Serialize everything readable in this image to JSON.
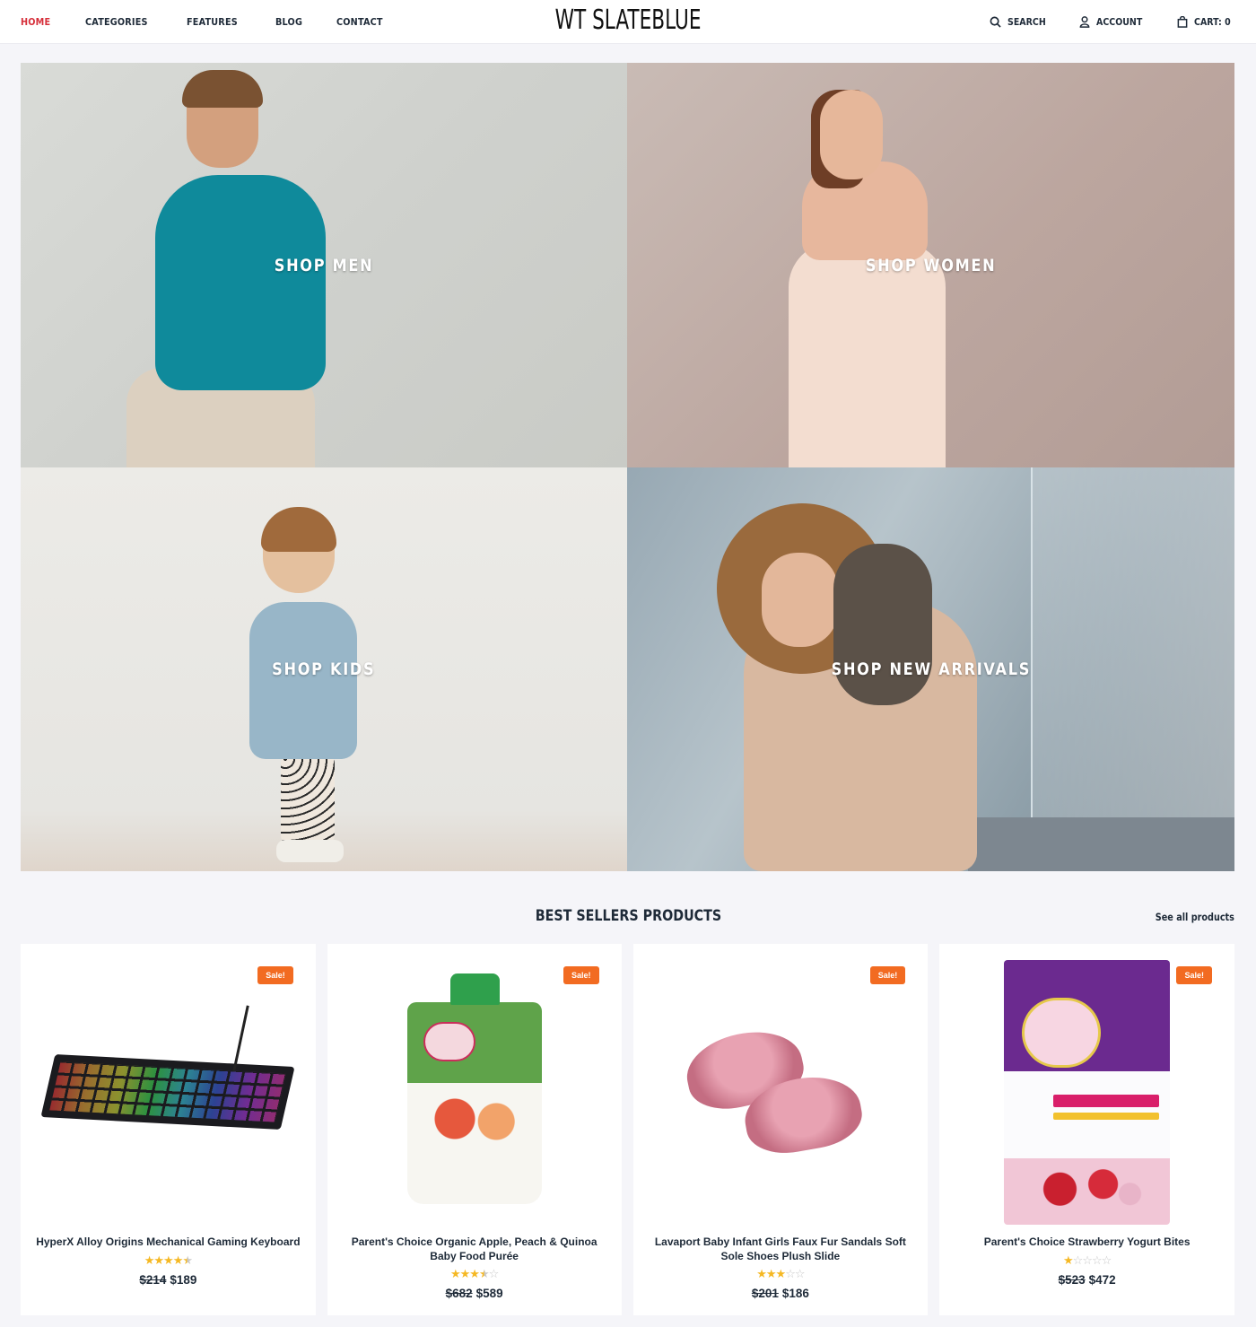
{
  "header": {
    "nav": [
      {
        "label": "HOME",
        "active": true
      },
      {
        "label": "CATEGORIES",
        "active": false
      },
      {
        "label": "FEATURES",
        "active": false
      },
      {
        "label": "BLOG",
        "active": false
      },
      {
        "label": "CONTACT",
        "active": false
      }
    ],
    "logo": "WT SLATEBLUE",
    "actions": {
      "search": {
        "label": "SEARCH",
        "icon": "search-icon"
      },
      "account": {
        "label": "ACCOUNT",
        "icon": "user-icon"
      },
      "cart": {
        "label": "CART: 0",
        "icon": "shopping-bag-icon"
      }
    },
    "active_color": "#d62f3a"
  },
  "banners": [
    {
      "caption": "SHOP MEN"
    },
    {
      "caption": "SHOP WOMEN"
    },
    {
      "caption": "SHOP KIDS"
    },
    {
      "caption": "SHOP NEW ARRIVALS"
    }
  ],
  "best_sellers": {
    "title": "BEST SELLERS PRODUCTS",
    "see_all": "See all products",
    "sale_color": "#f26b21",
    "products": [
      {
        "name": "HyperX Alloy Origins Mechanical Gaming Keyboard",
        "badge": "Sale!",
        "rating": 4.5,
        "rating_max": 5,
        "old_price": "$214",
        "price": "$189"
      },
      {
        "name": "Parent's Choice Organic Apple, Peach & Quinoa Baby Food Purée",
        "badge": "Sale!",
        "rating": 3.5,
        "rating_max": 5,
        "old_price": "$682",
        "price": "$589"
      },
      {
        "name": "Lavaport Baby Infant Girls Faux Fur Sandals Soft Sole Shoes Plush Slide",
        "badge": "Sale!",
        "rating": 3,
        "rating_max": 5,
        "old_price": "$201",
        "price": "$186"
      },
      {
        "name": "Parent's Choice Strawberry Yogurt Bites",
        "badge": "Sale!",
        "rating": 1,
        "rating_max": 5,
        "old_price": "$523",
        "price": "$472"
      }
    ]
  }
}
